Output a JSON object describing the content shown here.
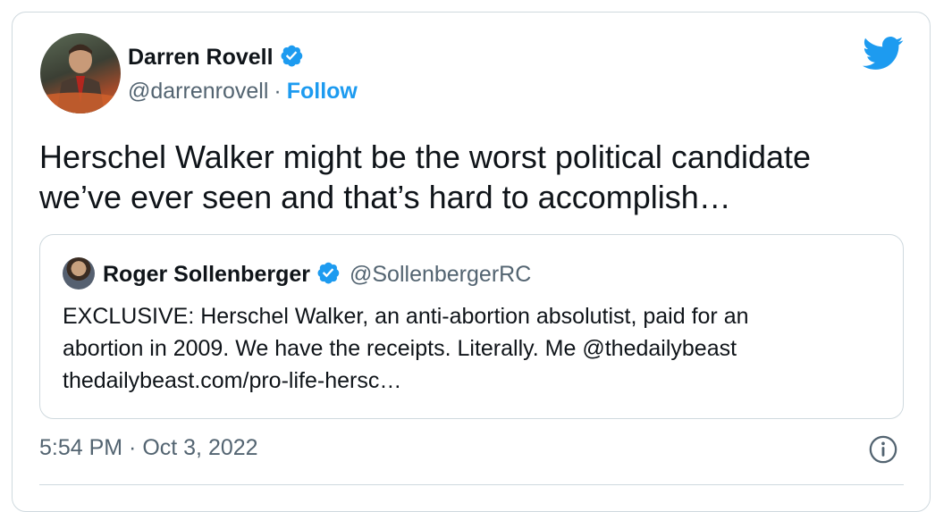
{
  "author": {
    "name": "Darren Rovell",
    "handle": "@darrenrovell",
    "separator": "·",
    "follow_label": "Follow"
  },
  "tweet": {
    "text_line1": "Herschel Walker might be the worst political candidate",
    "text_line2": "we’ve ever seen and that’s hard to accomplish…",
    "timestamp": "5:54 PM · Oct 3, 2022"
  },
  "quoted": {
    "name": "Roger Sollenberger",
    "handle": "@SollenbergerRC",
    "line1": "EXCLUSIVE: Herschel Walker, an anti-abortion absolutist, paid for an",
    "line2": "abortion in 2009. We have the receipts. Literally. Me @thedailybeast",
    "line3": "thedailybeast.com/pro-life-hersc…"
  },
  "icons": {
    "brand": "twitter-bird-icon",
    "verified": "verified-badge-icon",
    "info": "info-icon"
  },
  "colors": {
    "accent": "#1d9bf0",
    "text": "#0f1419",
    "secondary": "#536471",
    "border": "#cfd9de"
  }
}
